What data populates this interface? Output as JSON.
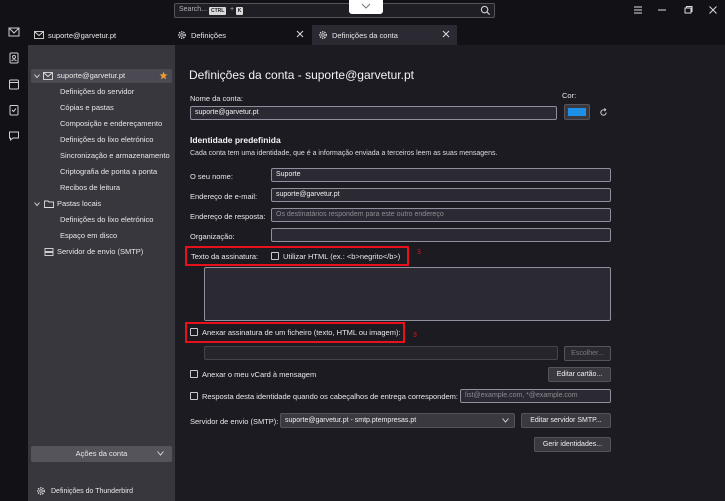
{
  "search": {
    "placeholder": "Search...",
    "kbd1": "CTRL",
    "plus": "+",
    "kbd2": "K"
  },
  "tabs": [
    {
      "label": "suporte@garvetur.pt"
    },
    {
      "label": "Definições"
    },
    {
      "label": "Definições da conta"
    }
  ],
  "sidebar": {
    "account": "suporte@garvetur.pt",
    "account_items": [
      "Definições do servidor",
      "Cópias e pastas",
      "Composição e endereçamento",
      "Definições do lixo eletrónico",
      "Sincronização e armazenamento",
      "Criptografia de ponta a ponta",
      "Recibos de leitura"
    ],
    "local_folders": "Pastas locais",
    "local_items": [
      "Definições do lixo eletrónico",
      "Espaço em disco"
    ],
    "smtp": "Servidor de envio (SMTP)",
    "account_actions": "Ações da conta",
    "footer": "Definições do Thunderbird"
  },
  "main": {
    "title": "Definições da conta - suporte@garvetur.pt",
    "account_name_label": "Nome da conta:",
    "account_name_value": "suporte@garvetur.pt",
    "color_label": "Cor:",
    "colors": {
      "swatch": "#1e90e8",
      "highlight": "#e8101b"
    },
    "identity_heading": "Identidade predefinida",
    "identity_desc": "Cada conta tem uma identidade, que é a informação enviada a terceiros leem as suas mensagens.",
    "name_label": "O seu nome:",
    "name_value": "Suporte",
    "email_label": "Endereço de e-mail:",
    "email_value": "suporte@garvetur.pt",
    "reply_label": "Endereço de resposta:",
    "reply_placeholder": "Os destinatários respondem para este outro endereço",
    "org_label": "Organização:",
    "org_value": "",
    "signature_label": "Texto da assinatura:",
    "html_label": "Utilizar HTML (ex.: <b>negrito</b>)",
    "attach_sig_label": "Anexar assinatura de um ficheiro (texto, HTML ou imagem):",
    "choose_btn": "Escolher...",
    "vcard_label": "Anexar o meu vCard à mensagem",
    "edit_card_btn": "Editar cartão...",
    "reply_identity_label": "Resposta desta identidade quando os cabeçalhos de entrega correspondem:",
    "reply_identity_placeholder": "list@example.com, *@example.com",
    "smtp_label": "Servidor de envio (SMTP):",
    "smtp_value": "suporte@garvetur.pt - smtp.ptempresas.pt",
    "edit_smtp_btn": "Editar servidor SMTP...",
    "manage_identities_btn": "Gerir identidades...",
    "annotation_1": "3",
    "annotation_2": "3"
  }
}
